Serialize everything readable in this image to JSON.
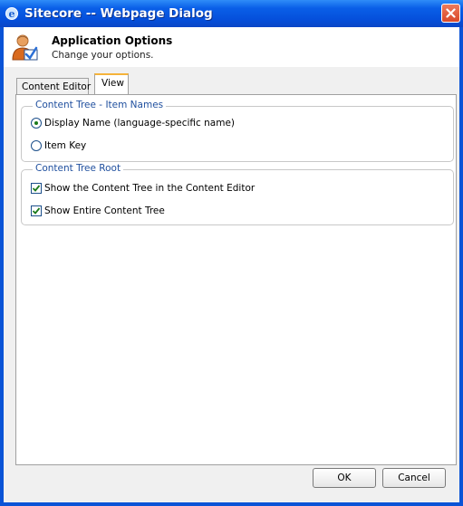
{
  "window": {
    "title": "Sitecore -- Webpage Dialog"
  },
  "header": {
    "title": "Application Options",
    "subtitle": "Change your options."
  },
  "tabs": [
    {
      "label": "Content Editor",
      "selected": false
    },
    {
      "label": "View",
      "selected": true
    }
  ],
  "groups": {
    "item_names": {
      "legend": "Content Tree - Item Names",
      "options": [
        {
          "label": "Display Name (language-specific name)",
          "checked": true
        },
        {
          "label": "Item Key",
          "checked": false
        }
      ]
    },
    "tree_root": {
      "legend": "Content Tree Root",
      "options": [
        {
          "label": "Show the Content Tree in the Content Editor",
          "checked": true
        },
        {
          "label": "Show Entire Content Tree",
          "checked": true
        }
      ]
    }
  },
  "buttons": {
    "ok": "OK",
    "cancel": "Cancel"
  },
  "colors": {
    "title_bar": "#0a5fe8",
    "legend_text": "#1f4f9e",
    "active_tab_accent": "#f5b33a",
    "close_button": "#d9492a"
  }
}
